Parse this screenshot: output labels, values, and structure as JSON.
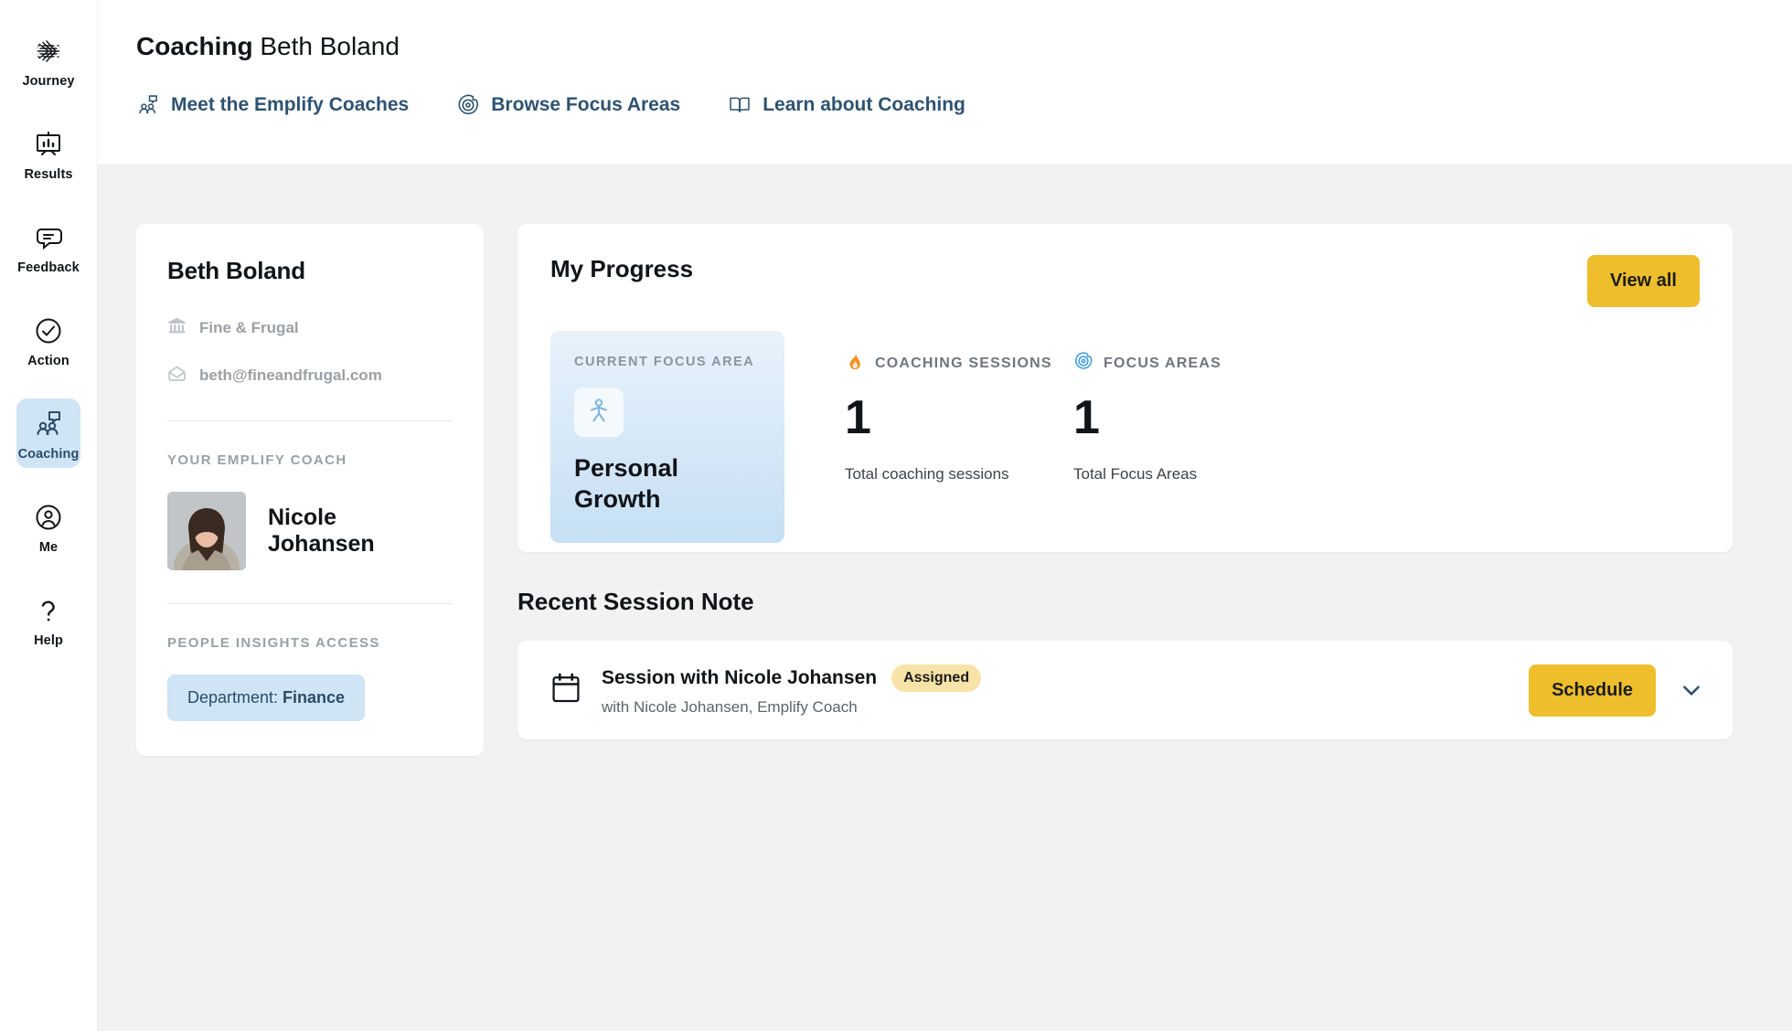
{
  "sidebar": {
    "items": [
      {
        "label": "Journey",
        "icon": "journey-icon",
        "active": false
      },
      {
        "label": "Results",
        "icon": "results-icon",
        "active": false
      },
      {
        "label": "Feedback",
        "icon": "feedback-icon",
        "active": false
      },
      {
        "label": "Action",
        "icon": "action-icon",
        "active": false
      },
      {
        "label": "Coaching",
        "icon": "coaching-icon",
        "active": true
      },
      {
        "label": "Me",
        "icon": "me-icon",
        "active": false
      },
      {
        "label": "Help",
        "icon": "help-icon",
        "active": false
      }
    ]
  },
  "header": {
    "title_bold": "Coaching",
    "title_rest": " Beth Boland",
    "nav": [
      {
        "label": "Meet the Emplify Coaches",
        "icon": "coaching-people-icon"
      },
      {
        "label": "Browse Focus Areas",
        "icon": "target-icon"
      },
      {
        "label": "Learn about Coaching",
        "icon": "open-book-icon"
      }
    ]
  },
  "profile": {
    "name": "Beth Boland",
    "company": "Fine & Frugal",
    "company_icon": "bank-icon",
    "email": "beth@fineandfrugal.com",
    "email_icon": "envelope-icon",
    "coach_section_label": "YOUR EMPLIFY COACH",
    "coach_name": "Nicole Johansen",
    "coach_photo_alt": "coach-avatar",
    "insights_label": "PEOPLE INSIGHTS ACCESS",
    "insights_chip_prefix": "Department: ",
    "insights_chip_value": "Finance"
  },
  "progress": {
    "title": "My Progress",
    "view_all_label": "View all",
    "focus": {
      "kicker": "CURRENT FOCUS AREA",
      "icon": "person-growth-icon",
      "name": "Personal Growth"
    },
    "stats": [
      {
        "icon": "flame-icon",
        "icon_color": "#f39228",
        "label": "COACHING SESSIONS",
        "value": "1",
        "sub": "Total coaching sessions"
      },
      {
        "icon": "target-icon",
        "icon_color": "#3d9de0",
        "label": "FOCUS AREAS",
        "value": "1",
        "sub": "Total Focus Areas"
      }
    ]
  },
  "recent": {
    "section_title": "Recent Session Note",
    "session": {
      "icon": "calendar-icon",
      "name": "Session with Nicole Johansen",
      "badge": "Assigned",
      "subtitle": "with Nicole Johansen, Emplify Coach",
      "action_label": "Schedule",
      "expand_icon": "chevron-down-icon"
    }
  },
  "colors": {
    "accent_yellow": "#eebe2c",
    "badge_yellow": "#f7e3a8",
    "active_blue": "#cfe4f5",
    "nav_blue": "#2e5271",
    "canvas": "#f2f2f2"
  }
}
